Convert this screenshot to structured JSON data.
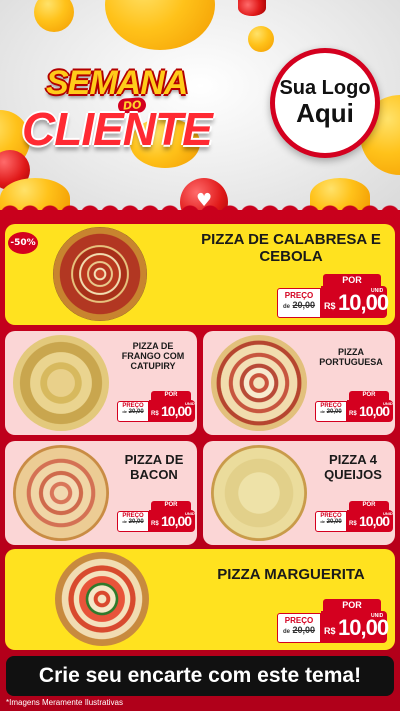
{
  "header": {
    "title_line1": "SEMANA",
    "title_line2": "DO",
    "title_line3": "CLIENTE",
    "logo_line1": "Sua Logo",
    "logo_line2": "Aqui"
  },
  "products": [
    {
      "name": "PIZZA DE CALABRESA E CEBOLA",
      "discount": "-50%",
      "por": "POR",
      "preco": "PREÇO",
      "de": "de",
      "old_price": "20,00",
      "rs": "R$",
      "price": "10,00",
      "unid": "UNID"
    },
    {
      "name": "PIZZA DE FRANGO COM CATUPIRY",
      "por": "POR",
      "preco": "PREÇO",
      "de": "de",
      "old_price": "20,00",
      "rs": "R$",
      "price": "10,00",
      "unid": "UNID"
    },
    {
      "name": "PIZZA PORTUGUESA",
      "por": "POR",
      "preco": "PREÇO",
      "de": "de",
      "old_price": "20,00",
      "rs": "R$",
      "price": "10,00",
      "unid": "UNID"
    },
    {
      "name": "PIZZA DE BACON",
      "por": "POR",
      "preco": "PREÇO",
      "de": "de",
      "old_price": "20,00",
      "rs": "R$",
      "price": "10,00",
      "unid": "UNID"
    },
    {
      "name": "PIZZA 4 QUEIJOS",
      "por": "POR",
      "preco": "PREÇO",
      "de": "de",
      "old_price": "20,00",
      "rs": "R$",
      "price": "10,00",
      "unid": "UNID"
    },
    {
      "name": "PIZZA MARGUERITA",
      "por": "POR",
      "preco": "PREÇO",
      "de": "de",
      "old_price": "20,00",
      "rs": "R$",
      "price": "10,00",
      "unid": "UNID"
    }
  ],
  "cta": "Crie seu encarte com este tema!",
  "footnote": "*Imagens Meramente Ilustrativas",
  "colors": {
    "red": "#d4001f",
    "yellow": "#ffe21f",
    "pink": "#fbd6d6"
  }
}
